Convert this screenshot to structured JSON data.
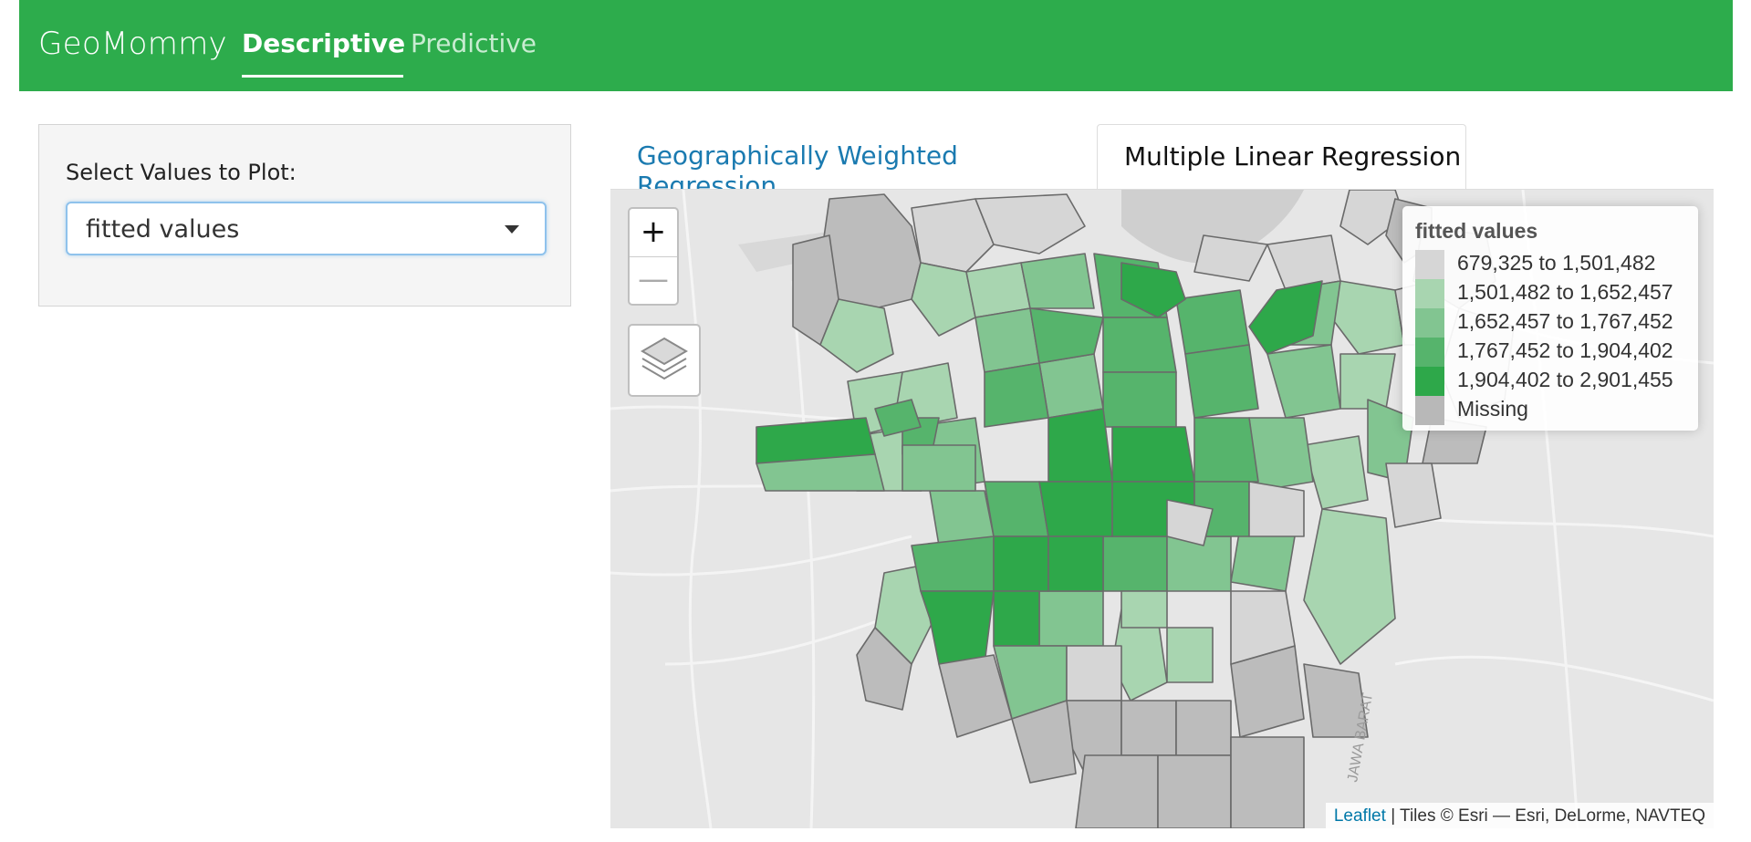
{
  "navbar": {
    "brand": "GeoMommy",
    "tabs": [
      {
        "label": "Descriptive",
        "active": true
      },
      {
        "label": "Predictive",
        "active": false
      }
    ],
    "color": "#2dac4c"
  },
  "sidebar": {
    "select_label": "Select Values to Plot:",
    "selected_value": "fitted values"
  },
  "tabs": [
    {
      "label": "Geographically Weighted Regression",
      "active": false
    },
    {
      "label": "Multiple Linear Regression",
      "active": true
    }
  ],
  "map": {
    "zoom_in_label": "+",
    "zoom_out_label": "—",
    "legend": {
      "title": "fitted values",
      "items": [
        {
          "label": "679,325 to 1,501,482",
          "color": "#d6d6d6"
        },
        {
          "label": "1,501,482 to 1,652,457",
          "color": "#a8d5b0"
        },
        {
          "label": "1,652,457 to 1,767,452",
          "color": "#82c591"
        },
        {
          "label": "1,767,452 to 1,904,402",
          "color": "#56b46c"
        },
        {
          "label": "1,904,402 to 2,901,455",
          "color": "#2ea84a"
        },
        {
          "label": "Missing",
          "color": "#b8b8b8"
        }
      ]
    },
    "attribution": {
      "link": "Leaflet",
      "text": "| Tiles © Esri — Esri, DeLorme, NAVTEQ"
    },
    "road_label": "JAWA BARAT"
  }
}
